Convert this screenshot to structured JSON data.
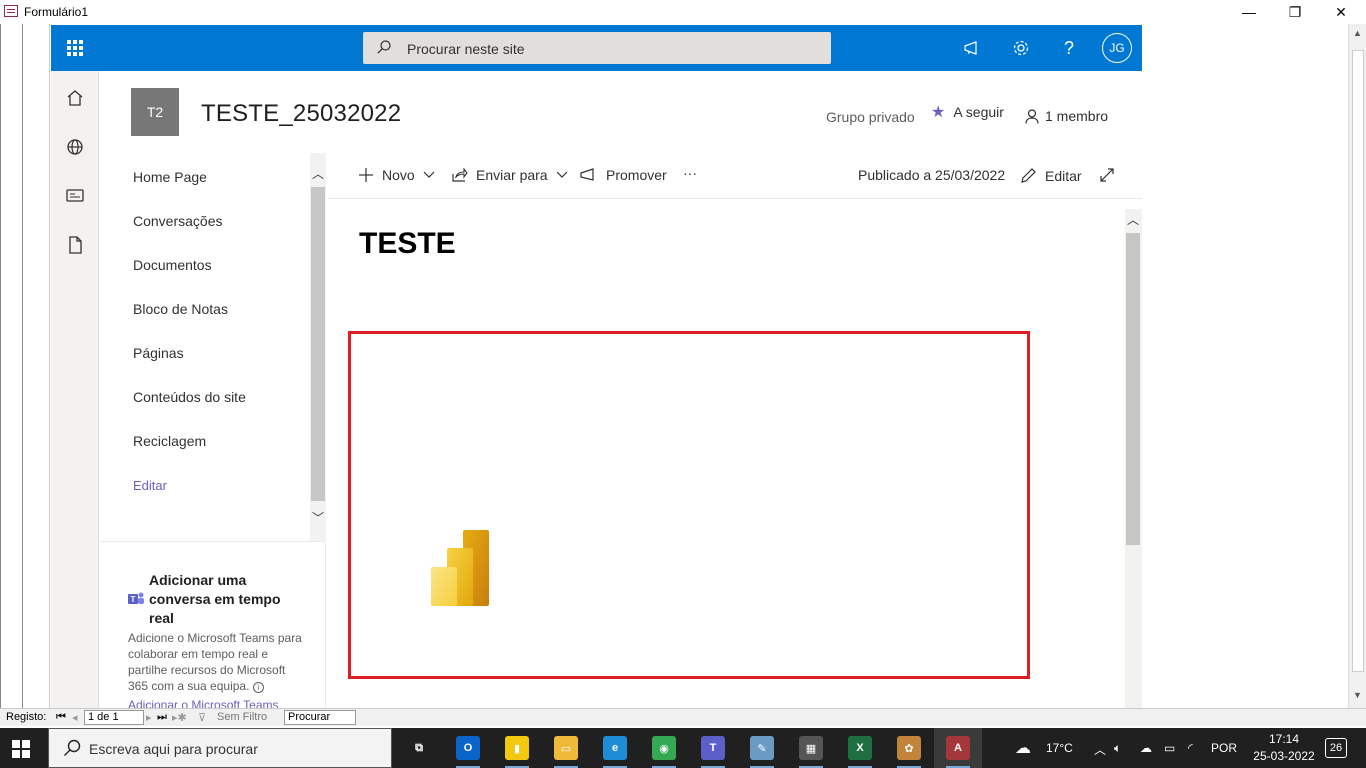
{
  "window": {
    "title": "Formulário1",
    "minimize": "—",
    "restore": "❐",
    "close": "✕"
  },
  "suitebar": {
    "search_placeholder": "Procurar neste site",
    "avatar_initials": "JG",
    "help": "?",
    "accent": "#0078d4"
  },
  "site": {
    "logo_text": "T2",
    "title": "TESTE_25032022",
    "privacy": "Grupo privado",
    "follow_label": "A seguir",
    "members_label": "1 membro"
  },
  "nav": {
    "items": [
      {
        "label": "Home Page"
      },
      {
        "label": "Conversações"
      },
      {
        "label": "Documentos"
      },
      {
        "label": "Bloco de Notas"
      },
      {
        "label": "Páginas"
      },
      {
        "label": "Conteúdos do site"
      },
      {
        "label": "Reciclagem"
      },
      {
        "label": "Editar"
      }
    ],
    "teams_heading": "Adicionar uma conversa em tempo real",
    "teams_description": "Adicione o Microsoft Teams para colaborar em tempo real e partilhe recursos do Microsoft 365 com a sua equipa.",
    "teams_link": "Adicionar o Microsoft Teams"
  },
  "commandbar": {
    "new_label": "Novo",
    "send_label": "Enviar para",
    "promote_label": "Promover",
    "more_label": "···",
    "published_label": "Publicado a 25/03/2022",
    "edit_label": "Editar"
  },
  "page": {
    "title": "TESTE",
    "highlight_color": "#e01d24"
  },
  "record_nav": {
    "label": "Registo:",
    "position": "1 de 1",
    "filter_label": "Sem Filtro",
    "search_label": "Procurar"
  },
  "taskbar": {
    "search_placeholder": "Escreva aqui para procurar",
    "weather": "17°C",
    "language": "POR",
    "time": "17:14",
    "date": "25-03-2022",
    "notifications": "26",
    "apps": [
      {
        "name": "task-view",
        "color": "#202020",
        "glyph": "⧉"
      },
      {
        "name": "outlook",
        "color": "#0a64c9",
        "glyph": "O"
      },
      {
        "name": "power-bi",
        "color": "#f2c811",
        "glyph": "▮"
      },
      {
        "name": "file-explorer",
        "color": "#f0b93a",
        "glyph": "▭"
      },
      {
        "name": "edge",
        "color": "#1e8dd6",
        "glyph": "e"
      },
      {
        "name": "chrome",
        "color": "#34a853",
        "glyph": "◉"
      },
      {
        "name": "teams",
        "color": "#5b5fc7",
        "glyph": "T"
      },
      {
        "name": "notes-app",
        "color": "#6b9ac4",
        "glyph": "✎"
      },
      {
        "name": "calculator",
        "color": "#555555",
        "glyph": "▦"
      },
      {
        "name": "excel",
        "color": "#1d6f42",
        "glyph": "X"
      },
      {
        "name": "paint",
        "color": "#c2843a",
        "glyph": "✿"
      },
      {
        "name": "access",
        "color": "#a4373a",
        "glyph": "A"
      }
    ]
  }
}
